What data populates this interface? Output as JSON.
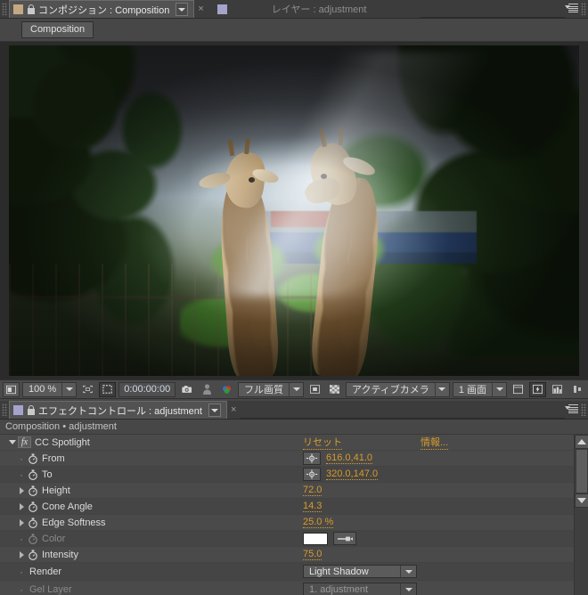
{
  "window": {
    "top_tabs": [
      {
        "label": "コンポジション : Composition",
        "active": true,
        "swatch_color": "#c4a882",
        "icon": "lock-icon",
        "has_dropdown": true,
        "closable": true
      },
      {
        "label": "レイヤー : adjustment",
        "active": false,
        "swatch_color": "#a3a3cc",
        "has_dropdown": false,
        "closable": false
      }
    ],
    "panel_menu_icon": "panel-menu-icon"
  },
  "comp_strip": {
    "button_label": "Composition"
  },
  "viewer": {
    "scene_description": "Two giraffes in a zoo enclosure with trees, a spotlight cone lighting the scene"
  },
  "viewer_toolbar": {
    "toggle_view_icon": "toggle-viewer-layout-icon",
    "magnification": "100 %",
    "magnification_caret": "chevron-down-icon",
    "region_of_interest_icon": "region-of-interest-icon",
    "transparency_grid_icon": "transparency-grid-icon",
    "current_time": "0:00:00:00",
    "snapshot_icon": "camera-icon",
    "show_snapshot_icon": "person-icon",
    "channels_icon": "channels-rgb-icon",
    "resolution": "フル画質",
    "resolution_caret": "chevron-down-icon",
    "mask_visibility_icon": "mask-visibility-icon",
    "toggle_alpha_icon": "checkerboard-icon",
    "camera_view": "アクティブカメラ",
    "camera_caret": "chevron-down-icon",
    "layout_views": "1 画面",
    "layout_caret": "chevron-down-icon",
    "guides_icon": "guides-icon",
    "fast_previews_icon": "fast-previews-lightning-icon",
    "timeline_icon": "timeline-icon",
    "comp_flowchart_icon": "flowchart-icon"
  },
  "effect_controls": {
    "tab_label": "エフェクトコントロール : adjustment",
    "tab_swatch_color": "#a3a3cc",
    "tab_icon": "lock-icon",
    "has_dropdown": true,
    "closable": true,
    "breadcrumb": "Composition • adjustment",
    "effect_name": "CC Spotlight",
    "fx_badge": "fx",
    "reset_label": "リセット",
    "about_label": "情報...",
    "properties": [
      {
        "name": "From",
        "value": "616.0,41.0",
        "control": "point",
        "has_twirl": false,
        "has_stopwatch": true,
        "enabled": true
      },
      {
        "name": "To",
        "value": "320.0,147.0",
        "control": "point",
        "has_twirl": false,
        "has_stopwatch": true,
        "enabled": true
      },
      {
        "name": "Height",
        "value": "72.0",
        "control": "number",
        "has_twirl": true,
        "has_stopwatch": true,
        "enabled": true
      },
      {
        "name": "Cone Angle",
        "value": "14.3",
        "control": "number",
        "has_twirl": true,
        "has_stopwatch": true,
        "enabled": true
      },
      {
        "name": "Edge Softness",
        "value": "25.0 %",
        "control": "number",
        "has_twirl": true,
        "has_stopwatch": true,
        "enabled": true
      },
      {
        "name": "Color",
        "value": "#ffffff",
        "control": "color",
        "has_twirl": false,
        "has_stopwatch": true,
        "enabled": false
      },
      {
        "name": "Intensity",
        "value": "75.0",
        "control": "number",
        "has_twirl": true,
        "has_stopwatch": true,
        "enabled": true
      },
      {
        "name": "Render",
        "value": "Light Shadow",
        "control": "select",
        "has_twirl": false,
        "has_stopwatch": false,
        "enabled": true
      },
      {
        "name": "Gel Layer",
        "value": "1. adjustment",
        "control": "select",
        "has_twirl": false,
        "has_stopwatch": false,
        "enabled": false
      }
    ],
    "scrollbar": {
      "up_icon": "scroll-up-arrow-icon",
      "down_icon": "scroll-down-arrow-icon"
    }
  },
  "colors": {
    "accent_orange": "#d89b2c",
    "panel_bg": "#4a4a4a",
    "chrome_bg": "#3c3c3c",
    "viewer_bg": "#2b2b2b",
    "text": "#d2d2d2"
  }
}
